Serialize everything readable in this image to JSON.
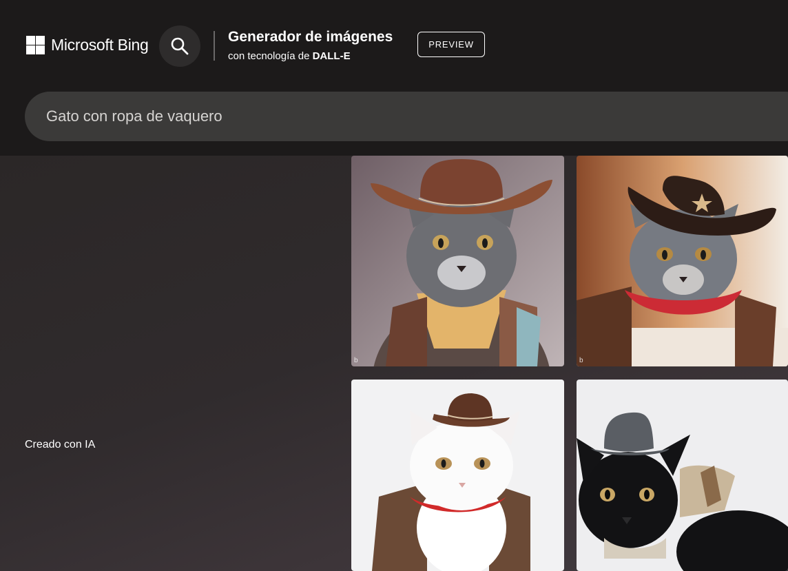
{
  "brand": {
    "name": "Microsoft Bing",
    "logo_icon": "microsoft-windows-logo"
  },
  "header": {
    "search_icon": "search-icon",
    "title": "Generador de imágenes",
    "subtitle_prefix": "con tecnología de ",
    "subtitle_brand": "DALL-E",
    "preview_label": "PREVIEW"
  },
  "prompt": {
    "value": "Gato con ropa de vaquero"
  },
  "content": {
    "ai_label": "Creado con IA",
    "images": [
      {
        "subject": "gray cat, brown cowboy hat, yellow bandana, denim shirt",
        "watermark": "b"
      },
      {
        "subject": "gray cat, dark cowboy hat with star, red bandana, leather vest",
        "watermark": "b"
      },
      {
        "subject": "white cat, small brown cowboy hat, red bandana, leather vest"
      },
      {
        "subject": "black cat, gray hat, plaid scarf"
      }
    ]
  },
  "colors": {
    "header_bg": "#1c1a1a",
    "prompt_bg": "#3b3a39",
    "text": "#ffffff"
  }
}
